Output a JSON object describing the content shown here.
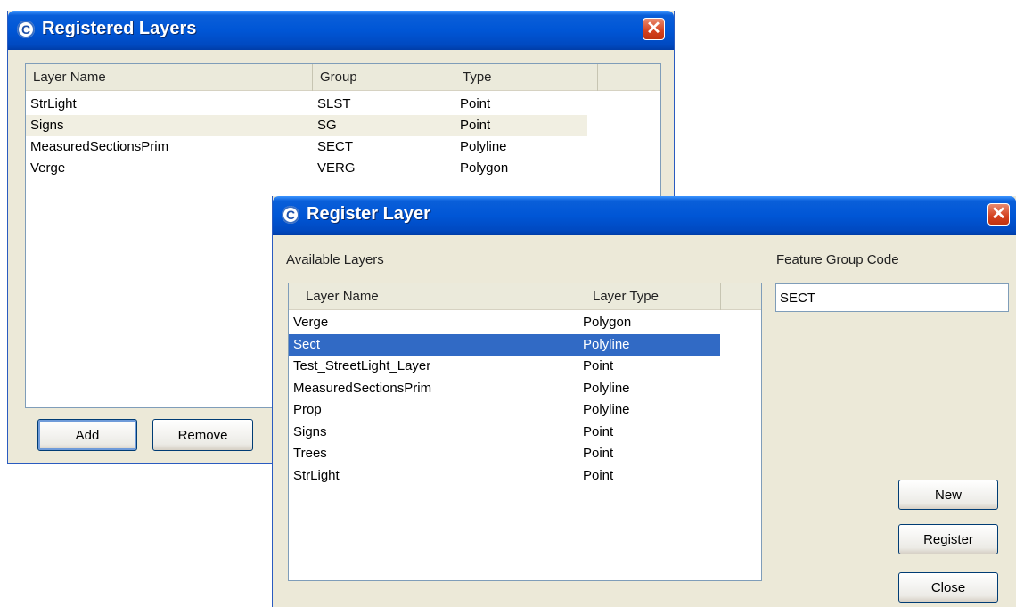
{
  "registered_layers": {
    "title": "Registered Layers",
    "close_glyph": "✕",
    "app_icon_glyph": "C",
    "columns": [
      "Layer Name",
      "Group",
      "Type"
    ],
    "rows": [
      {
        "name": "StrLight",
        "group": "SLST",
        "type": "Point"
      },
      {
        "name": "Signs",
        "group": "SG",
        "type": "Point"
      },
      {
        "name": "MeasuredSectionsPrim",
        "group": "SECT",
        "type": "Polyline"
      },
      {
        "name": "Verge",
        "group": "VERG",
        "type": "Polygon"
      }
    ],
    "add_label": "Add",
    "remove_label": "Remove"
  },
  "register_layer": {
    "title": "Register Layer",
    "close_glyph": "✕",
    "app_icon_glyph": "C",
    "available_layers_label": "Available Layers",
    "feature_group_code_label": "Feature Group Code",
    "feature_group_code_value": "SECT",
    "columns": [
      "Layer Name",
      "Layer Type"
    ],
    "rows": [
      {
        "name": "Verge",
        "type": "Polygon"
      },
      {
        "name": "Sect",
        "type": "Polyline",
        "selected": true
      },
      {
        "name": "Test_StreetLight_Layer",
        "type": "Point"
      },
      {
        "name": "MeasuredSectionsPrim",
        "type": "Polyline"
      },
      {
        "name": "Prop",
        "type": "Polyline"
      },
      {
        "name": "Signs",
        "type": "Point"
      },
      {
        "name": "Trees",
        "type": "Point"
      },
      {
        "name": "StrLight",
        "type": "Point"
      }
    ],
    "new_label": "New",
    "register_label": "Register",
    "close_label": "Close"
  },
  "colors": {
    "title_bar": "#0056d6",
    "selection": "#316ac5",
    "window_face": "#ece9d8"
  }
}
